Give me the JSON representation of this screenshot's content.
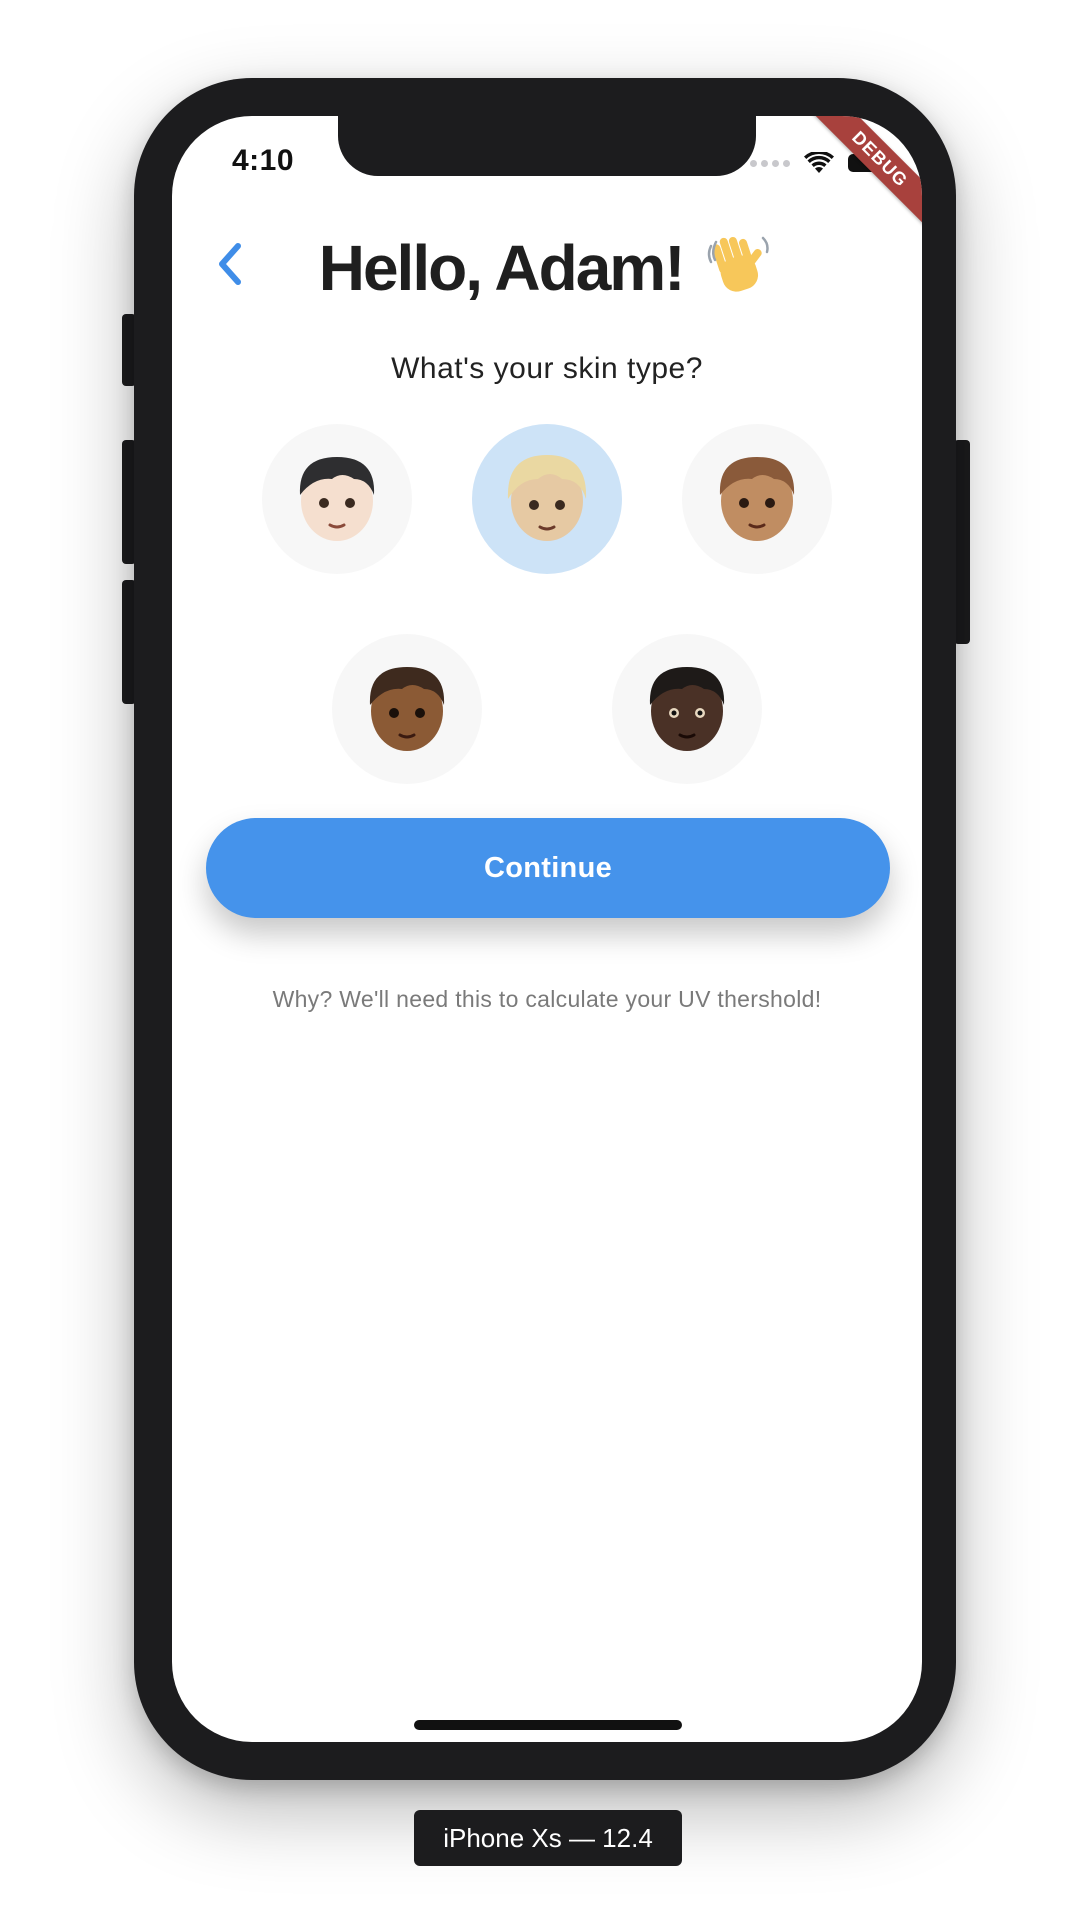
{
  "status_bar": {
    "time": "4:10",
    "debug_banner": "DEBUG"
  },
  "header": {
    "title": "Hello, Adam!",
    "title_emoji": "👋"
  },
  "question": "What's your skin type?",
  "skin_types": [
    {
      "id": "light",
      "emoji": "🧑🏻",
      "skin_color": "#f5dfcf",
      "hair_color": "#2e2e30",
      "selected": false
    },
    {
      "id": "medium-light",
      "emoji": "👱🏼",
      "skin_color": "#e6c9a3",
      "hair_color": "#e8d7a0",
      "selected": true
    },
    {
      "id": "medium",
      "emoji": "🧑🏽",
      "skin_color": "#c08d62",
      "hair_color": "#8a5a3a",
      "selected": false
    },
    {
      "id": "medium-dark",
      "emoji": "🧑🏾",
      "skin_color": "#8b5a35",
      "hair_color": "#3e2a1e",
      "selected": false
    },
    {
      "id": "dark",
      "emoji": "🧑🏿",
      "skin_color": "#4a3126",
      "hair_color": "#1e1a18",
      "selected": false
    }
  ],
  "continue_label": "Continue",
  "hint": "Why? We'll need this to calculate your UV thershold!",
  "device_label": "iPhone Xs — 12.4",
  "colors": {
    "accent": "#4593eb",
    "selected_bg": "#cde3f7",
    "option_bg": "#f7f7f7",
    "debug_ribbon": "#a8413d"
  }
}
